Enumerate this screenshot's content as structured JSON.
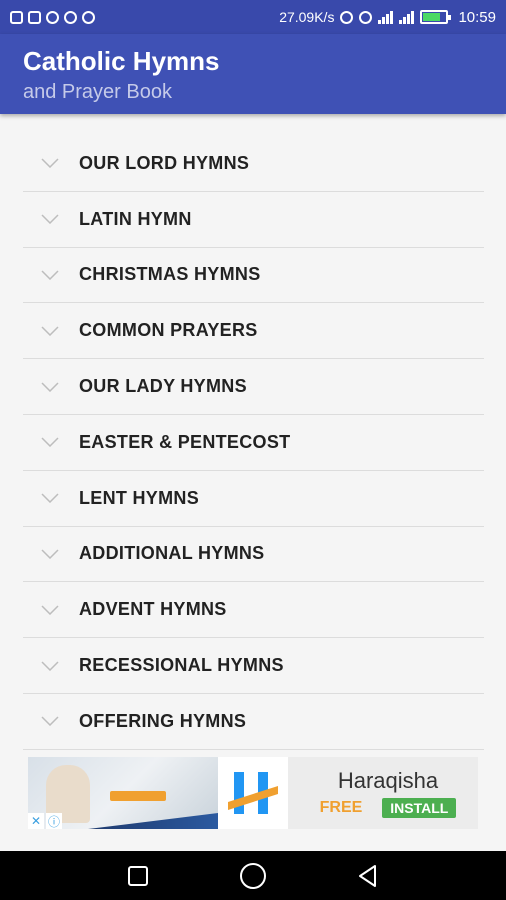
{
  "status_bar": {
    "speed": "27.09K/s",
    "time": "10:59"
  },
  "app_bar": {
    "title": "Catholic Hymns",
    "subtitle": "and Prayer Book"
  },
  "categories": [
    {
      "label": "OUR LORD HYMNS"
    },
    {
      "label": "LATIN HYMN"
    },
    {
      "label": "CHRISTMAS HYMNS"
    },
    {
      "label": "COMMON PRAYERS"
    },
    {
      "label": "OUR LADY HYMNS"
    },
    {
      "label": "EASTER & PENTECOST"
    },
    {
      "label": "LENT HYMNS"
    },
    {
      "label": "ADDITIONAL HYMNS"
    },
    {
      "label": "ADVENT HYMNS"
    },
    {
      "label": "RECESSIONAL HYMNS"
    },
    {
      "label": "OFFERING HYMNS"
    }
  ],
  "ad": {
    "name": "Haraqisha",
    "price": "FREE",
    "cta": "INSTALL",
    "accent": "#4caf50",
    "price_color": "#f0a030"
  },
  "colors": {
    "status_bar": "#3949ab",
    "app_bar": "#3f51b5"
  },
  "icons": {
    "row_expand": "chevron-down-icon",
    "nav_recents": "square-icon",
    "nav_home": "circle-icon",
    "nav_back": "triangle-back-icon"
  }
}
